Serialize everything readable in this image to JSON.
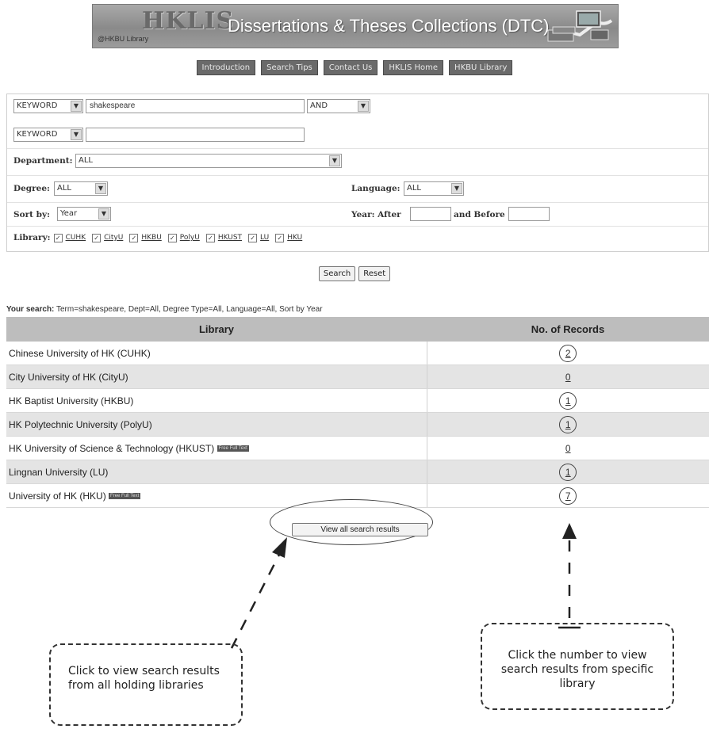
{
  "banner": {
    "logo": "HKLIS",
    "sub": "@HKBU Library",
    "title": "Dissertations & Theses Collections (DTC)"
  },
  "nav": [
    "Introduction",
    "Search Tips",
    "Contact Us",
    "HKLIS Home",
    "HKBU Library"
  ],
  "form": {
    "field1_type": "KEYWORD",
    "field1_value": "shakespeare",
    "operator": "AND",
    "field2_type": "KEYWORD",
    "field2_value": "",
    "department_label": "Department:",
    "department_value": "ALL",
    "degree_label": "Degree:",
    "degree_value": "ALL",
    "language_label": "Language:",
    "language_value": "ALL",
    "sortby_label": "Sort by:",
    "sortby_value": "Year",
    "year_after_label": "Year: After",
    "year_before_label": "and Before",
    "library_label": "Library:",
    "libraries": [
      "CUHK",
      "CityU",
      "HKBU",
      "PolyU",
      "HKUST",
      "LU",
      "HKU"
    ]
  },
  "buttons": {
    "search": "Search",
    "reset": "Reset"
  },
  "your_search": {
    "label": "Your search:",
    "text": " Term=shakespeare, Dept=All, Degree Type=All, Language=All, Sort by Year"
  },
  "table": {
    "col_library": "Library",
    "col_records": "No. of Records",
    "free_full_text": "Free Full Text",
    "rows": [
      {
        "library": "Chinese University of HK (CUHK)",
        "records": "2"
      },
      {
        "library": "City University of HK (CityU)",
        "records": "0"
      },
      {
        "library": "HK Baptist University (HKBU)",
        "records": "1"
      },
      {
        "library": "HK Polytechnic University (PolyU)",
        "records": "1"
      },
      {
        "library": "HK University of Science & Technology (HKUST)",
        "records": "0"
      },
      {
        "library": "Lingnan University (LU)",
        "records": "1"
      },
      {
        "library": "University of HK (HKU)",
        "records": "7"
      }
    ]
  },
  "view_all": "View all search results",
  "callout_left": "Click to view search results from all holding libraries",
  "callout_right": "Click the number to view search results from specific library"
}
